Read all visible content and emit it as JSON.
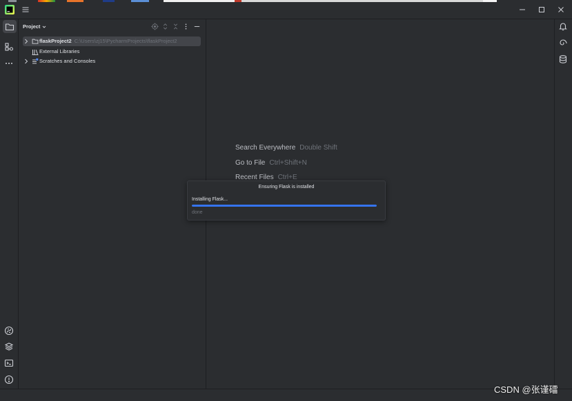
{
  "window": {
    "app_icon": "pycharm-logo-icon",
    "menu_icon": "hamburger-menu-icon",
    "controls": [
      "minimize-icon",
      "maximize-icon",
      "close-icon"
    ]
  },
  "left_toolbar": {
    "top": [
      {
        "icon": "folder-icon",
        "selected": true
      },
      {
        "icon": "structure-icon",
        "selected": false
      },
      {
        "icon": "more-horizontal-icon",
        "selected": false
      }
    ],
    "bottom": [
      {
        "icon": "python-console-icon"
      },
      {
        "icon": "python-packages-icon"
      },
      {
        "icon": "terminal-icon"
      },
      {
        "icon": "problems-icon"
      }
    ]
  },
  "project_panel": {
    "title": "Project",
    "title_icon": "chevron-down-icon",
    "header_icons": [
      "locate-icon",
      "expand-all-icon",
      "collapse-all-icon",
      "more-vertical-icon",
      "minimize-panel-icon"
    ],
    "tree": [
      {
        "name": "flaskProject2",
        "path": "C:\\Users\\zj15\\PycharmProjects\\flaskProject2",
        "icon": "folder-icon",
        "expandable": true,
        "selected": true
      },
      {
        "name": "External Libraries",
        "icon": "library-icon",
        "expandable": false,
        "selected": false
      },
      {
        "name": "Scratches and Consoles",
        "icon": "scratches-icon",
        "expandable": true,
        "selected": false
      }
    ]
  },
  "editor": {
    "hints": [
      {
        "action": "Search Everywhere",
        "shortcut": "Double Shift"
      },
      {
        "action": "Go to File",
        "shortcut": "Ctrl+Shift+N"
      },
      {
        "action": "Recent Files",
        "shortcut": "Ctrl+E"
      }
    ]
  },
  "progress_dialog": {
    "title": "Ensuring Flask is installed",
    "status": "Installing Flask...",
    "progress": 1.0,
    "detail": "done"
  },
  "right_toolbar": [
    {
      "icon": "bell-icon"
    },
    {
      "icon": "ai-assistant-icon"
    },
    {
      "icon": "database-icon"
    }
  ],
  "watermark": "CSDN @张谨礌",
  "colors": {
    "accent": "#3574f0",
    "selection": "#43454a",
    "background": "#2b2d30"
  }
}
